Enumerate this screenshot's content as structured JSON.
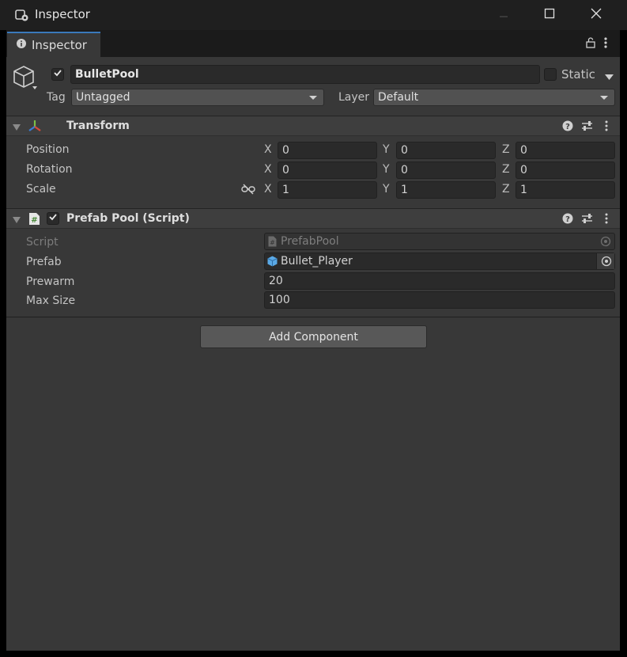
{
  "window": {
    "title": "Inspector"
  },
  "tab": {
    "label": "Inspector"
  },
  "gameobject": {
    "name": "BulletPool",
    "active": true,
    "static_label": "Static",
    "static": false,
    "tag_label": "Tag",
    "tag_value": "Untagged",
    "layer_label": "Layer",
    "layer_value": "Default"
  },
  "transform": {
    "title": "Transform",
    "rows": [
      {
        "label": "Position",
        "x": "0",
        "y": "0",
        "z": "0"
      },
      {
        "label": "Rotation",
        "x": "0",
        "y": "0",
        "z": "0"
      },
      {
        "label": "Scale",
        "x": "1",
        "y": "1",
        "z": "1"
      }
    ],
    "axes": {
      "x": "X",
      "y": "Y",
      "z": "Z"
    }
  },
  "prefab_pool": {
    "title": "Prefab Pool (Script)",
    "enabled": true,
    "script_label": "Script",
    "script_value": "PrefabPool",
    "prefab_label": "Prefab",
    "prefab_value": "Bullet_Player",
    "prewarm_label": "Prewarm",
    "prewarm_value": "20",
    "maxsize_label": "Max Size",
    "maxsize_value": "100"
  },
  "add_component_label": "Add Component",
  "colors": {
    "accent": "#3a79bb",
    "panel": "#383838",
    "field": "#2a2a2a",
    "header": "#3e3e3e"
  }
}
